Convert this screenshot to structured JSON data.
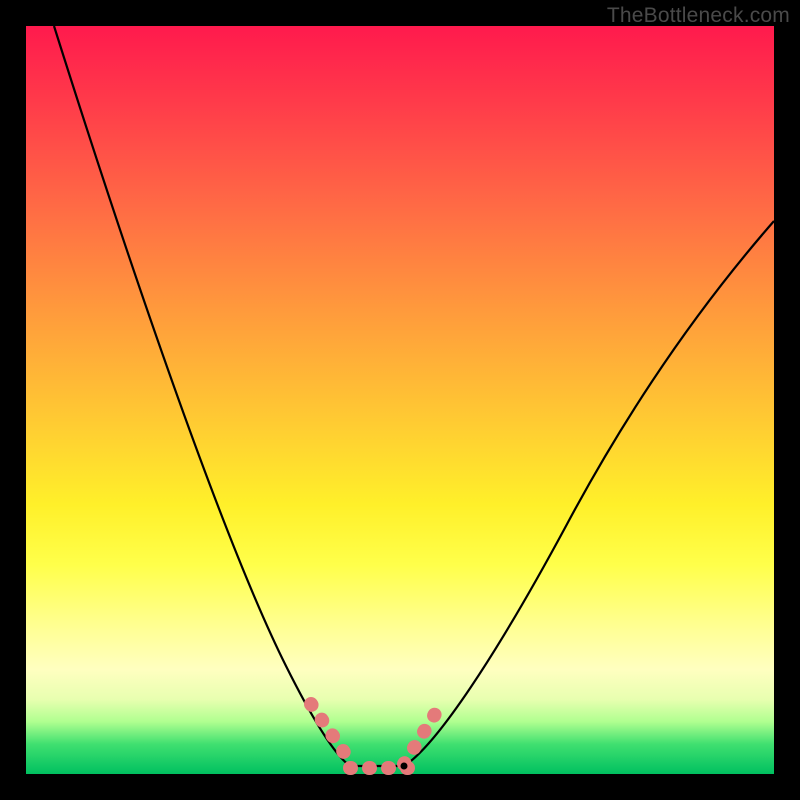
{
  "watermark": "TheBottleneck.com",
  "chart_data": {
    "type": "line",
    "title": "",
    "xlabel": "",
    "ylabel": "",
    "xlim": [
      0,
      100
    ],
    "ylim": [
      0,
      100
    ],
    "note": "Bottleneck-style curve: two black arcs meeting at a flat minimum with pink dotted marks near the trough; rainbow gradient background red→green top→bottom.",
    "series": [
      {
        "name": "left-curve",
        "x": [
          3,
          10,
          18,
          25,
          30,
          34,
          37,
          39,
          41,
          43
        ],
        "values": [
          100,
          80,
          58,
          38,
          24,
          14,
          8,
          4,
          2,
          1
        ]
      },
      {
        "name": "floor",
        "x": [
          43,
          50
        ],
        "values": [
          0.5,
          0.5
        ]
      },
      {
        "name": "right-curve",
        "x": [
          50,
          54,
          60,
          68,
          78,
          90,
          100
        ],
        "values": [
          1,
          4,
          12,
          25,
          42,
          60,
          74
        ]
      }
    ],
    "markers": {
      "color": "#e47a7a",
      "left_segment": {
        "x": [
          38,
          44
        ],
        "y": [
          9,
          1
        ]
      },
      "floor_segment": {
        "x": [
          43,
          51
        ],
        "y": [
          0.5,
          0.5
        ]
      },
      "right_segment": {
        "x": [
          50,
          55
        ],
        "y": [
          1,
          8
        ]
      }
    }
  }
}
